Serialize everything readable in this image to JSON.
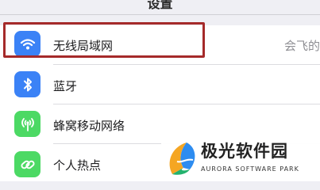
{
  "nav": {
    "title": "设置"
  },
  "settings": {
    "rows": [
      {
        "label": "无线局域网",
        "value": "会飞的",
        "icon": "wifi-icon",
        "color": "#3b82f6"
      },
      {
        "label": "蓝牙",
        "icon": "bluetooth-icon",
        "color": "#3b82f6"
      },
      {
        "label": "蜂窝移动网络",
        "icon": "antenna-icon",
        "color": "#4cd964"
      },
      {
        "label": "个人热点",
        "icon": "hotspot-link-icon",
        "color": "#4cd964"
      }
    ]
  },
  "highlight": {
    "color": "#a52a2a"
  },
  "watermark": {
    "name": "极光软件园",
    "subtitle": "AURORA SOFTWARE PARK"
  }
}
